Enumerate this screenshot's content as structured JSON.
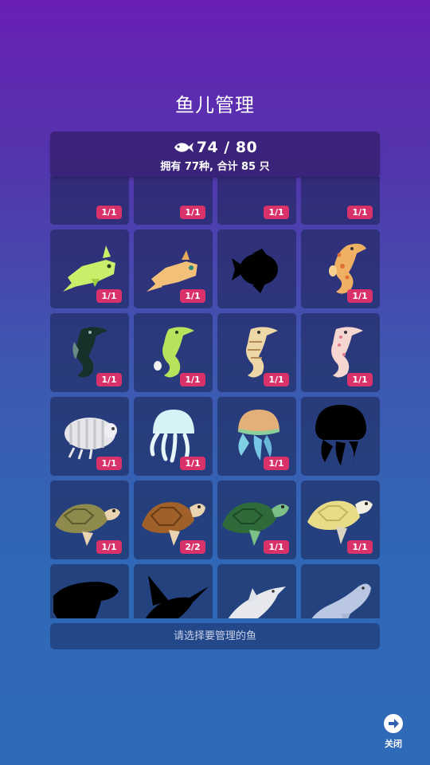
{
  "screen": {
    "title": "鱼儿管理"
  },
  "header": {
    "count_text": "74 / 80",
    "summary_text": "拥有 77种, 合计 85 只",
    "fish_icon": "fish-icon"
  },
  "grid": {
    "cells": [
      {
        "name": "partial-fish-1",
        "badge": "1/1",
        "kind": "partial-a"
      },
      {
        "name": "partial-fish-2",
        "badge": "1/1",
        "kind": "partial-b"
      },
      {
        "name": "partial-fish-3",
        "badge": "1/1",
        "kind": "partial-c"
      },
      {
        "name": "partial-fish-4",
        "badge": "1/1",
        "kind": "partial-d"
      },
      {
        "name": "green-cowfish",
        "badge": "1/1",
        "kind": "cowfish-green"
      },
      {
        "name": "orange-cowfish",
        "badge": "1/1",
        "kind": "cowfish-orange"
      },
      {
        "name": "locked-silhouette-fish",
        "badge": "",
        "kind": "silhouette-fish"
      },
      {
        "name": "orange-seahorse",
        "badge": "1/1",
        "kind": "seahorse-orange"
      },
      {
        "name": "dark-seahorse",
        "badge": "1/1",
        "kind": "seahorse-dark"
      },
      {
        "name": "green-seahorse",
        "badge": "1/1",
        "kind": "seahorse-green"
      },
      {
        "name": "tan-seahorse",
        "badge": "1/1",
        "kind": "seahorse-tan"
      },
      {
        "name": "pink-seahorse",
        "badge": "1/1",
        "kind": "seahorse-pink"
      },
      {
        "name": "isopod",
        "badge": "1/1",
        "kind": "isopod"
      },
      {
        "name": "moon-jellyfish",
        "badge": "1/1",
        "kind": "jelly-white"
      },
      {
        "name": "rainbow-jellyfish",
        "badge": "1/1",
        "kind": "jelly-rainbow"
      },
      {
        "name": "locked-silhouette-jellyfish",
        "badge": "",
        "kind": "jelly-silhouette"
      },
      {
        "name": "olive-sea-turtle",
        "badge": "1/1",
        "kind": "turtle-olive"
      },
      {
        "name": "loggerhead-turtle",
        "badge": "2/2",
        "kind": "turtle-brown"
      },
      {
        "name": "green-sea-turtle",
        "badge": "1/1",
        "kind": "turtle-green"
      },
      {
        "name": "hawksbill-turtle",
        "badge": "1/1",
        "kind": "turtle-yellow"
      },
      {
        "name": "locked-silhouette-whale",
        "badge": "",
        "kind": "whale-silhouette"
      },
      {
        "name": "locked-silhouette-swordfish",
        "badge": "",
        "kind": "swordfish-silhouette"
      },
      {
        "name": "white-dolphin",
        "badge": "1/1",
        "kind": "dolphin-white"
      },
      {
        "name": "beluga-whale",
        "badge": "1/1",
        "kind": "beluga"
      }
    ]
  },
  "footer": {
    "hint_text": "请选择要管理的鱼",
    "close_label": "关闭",
    "close_icon": "arrow-right-icon"
  }
}
